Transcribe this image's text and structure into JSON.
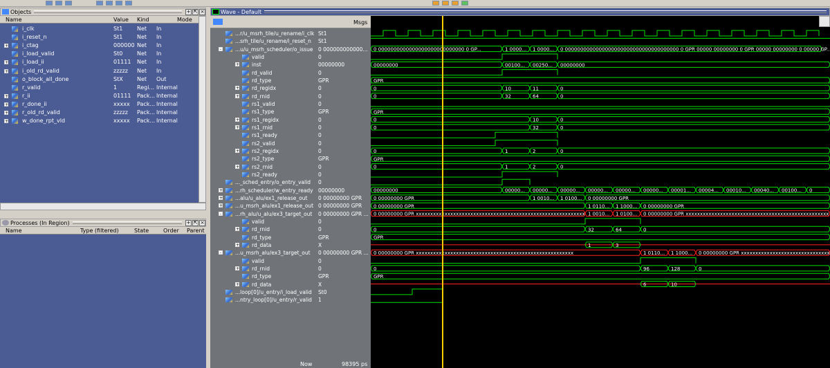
{
  "objects": {
    "title": "Objects",
    "columns": [
      "Name",
      "Value",
      "Kind",
      "Mode"
    ],
    "rows": [
      {
        "name": "i_clk",
        "value": "St1",
        "kind": "Net",
        "mode": "In",
        "expand": false
      },
      {
        "name": "i_reset_n",
        "value": "St1",
        "kind": "Net",
        "mode": "In",
        "expand": false
      },
      {
        "name": "i_ctag",
        "value": "000000",
        "kind": "Net",
        "mode": "In",
        "expand": true
      },
      {
        "name": "i_load_valid",
        "value": "St0",
        "kind": "Net",
        "mode": "In",
        "expand": false
      },
      {
        "name": "i_load_ii",
        "value": "01111",
        "kind": "Net",
        "mode": "In",
        "expand": true
      },
      {
        "name": "i_old_rd_valid",
        "value": "zzzzz",
        "kind": "Net",
        "mode": "In",
        "expand": true
      },
      {
        "name": "o_block_all_done",
        "value": "StX",
        "kind": "Net",
        "mode": "Out",
        "expand": false
      },
      {
        "name": "r_valid",
        "value": "1",
        "kind": "Regi...",
        "mode": "Internal",
        "expand": false
      },
      {
        "name": "r_ii",
        "value": "01111",
        "kind": "Pack...",
        "mode": "Internal",
        "expand": true
      },
      {
        "name": "r_done_ii",
        "value": "xxxxx",
        "kind": "Pack...",
        "mode": "Internal",
        "expand": true
      },
      {
        "name": "r_old_rd_valid",
        "value": "zzzzz",
        "kind": "Pack...",
        "mode": "Internal",
        "expand": true
      },
      {
        "name": "w_done_rpt_vld",
        "value": "xxxxx",
        "kind": "Pack...",
        "mode": "Internal",
        "expand": true
      }
    ]
  },
  "processes": {
    "title": "Processes (In Region)",
    "columns": [
      "Name",
      "Type (filtered)",
      "State",
      "Order",
      "Parent"
    ]
  },
  "wave": {
    "title": "Wave - Default",
    "msgs_label": "Msgs",
    "now_label": "Now",
    "now_value": "98395 ps",
    "signals": [
      {
        "name": "...r/u_msrh_tile/u_rename/i_clk",
        "value": "St1",
        "level": 0,
        "expand": ""
      },
      {
        "name": "...srh_tile/u_rename/i_reset_n",
        "value": "St1",
        "level": 0,
        "expand": ""
      },
      {
        "name": "...u/u_msrh_scheduler/o_issue",
        "value": "0 000000000000...",
        "level": 0,
        "expand": "-"
      },
      {
        "name": "valid",
        "value": "0",
        "level": 1,
        "expand": ""
      },
      {
        "name": "inst",
        "value": "00000000",
        "level": 1,
        "expand": "+"
      },
      {
        "name": "rd_valid",
        "value": "0",
        "level": 1,
        "expand": ""
      },
      {
        "name": "rd_type",
        "value": "GPR",
        "level": 1,
        "expand": ""
      },
      {
        "name": "rd_regidx",
        "value": "0",
        "level": 1,
        "expand": "+"
      },
      {
        "name": "rd_rnid",
        "value": "0",
        "level": 1,
        "expand": "+"
      },
      {
        "name": "rs1_valid",
        "value": "0",
        "level": 1,
        "expand": ""
      },
      {
        "name": "rs1_type",
        "value": "GPR",
        "level": 1,
        "expand": ""
      },
      {
        "name": "rs1_regidx",
        "value": "0",
        "level": 1,
        "expand": "+"
      },
      {
        "name": "rs1_rnid",
        "value": "0",
        "level": 1,
        "expand": "+"
      },
      {
        "name": "rs1_ready",
        "value": "0",
        "level": 1,
        "expand": ""
      },
      {
        "name": "rs2_valid",
        "value": "0",
        "level": 1,
        "expand": ""
      },
      {
        "name": "rs2_regidx",
        "value": "0",
        "level": 1,
        "expand": "+"
      },
      {
        "name": "rs2_type",
        "value": "GPR",
        "level": 1,
        "expand": ""
      },
      {
        "name": "rs2_rnid",
        "value": "0",
        "level": 1,
        "expand": "+"
      },
      {
        "name": "rs2_ready",
        "value": "0",
        "level": 1,
        "expand": ""
      },
      {
        "name": "..._sched_entry/o_entry_valid",
        "value": "0",
        "level": 0,
        "expand": ""
      },
      {
        "name": "...rh_scheduler/w_entry_ready",
        "value": "00000000",
        "level": 0,
        "expand": "+"
      },
      {
        "name": "...alu/u_alu/ex1_release_out",
        "value": "0 00000000 GPR",
        "level": 0,
        "expand": "+"
      },
      {
        "name": "...u_msrh_alu/ex1_release_out",
        "value": "0 00000000 GPR",
        "level": 0,
        "expand": "+"
      },
      {
        "name": "...rh_alu/u_alu/ex3_target_out",
        "value": "0 00000000 GPR ...",
        "level": 0,
        "expand": "-"
      },
      {
        "name": "valid",
        "value": "0",
        "level": 1,
        "expand": ""
      },
      {
        "name": "rd_rnid",
        "value": "0",
        "level": 1,
        "expand": "+"
      },
      {
        "name": "rd_type",
        "value": "GPR",
        "level": 1,
        "expand": ""
      },
      {
        "name": "rd_data",
        "value": "X",
        "level": 1,
        "expand": "+"
      },
      {
        "name": "...u_msrh_alu/ex3_target_out",
        "value": "0 00000000 GPR ...",
        "level": 0,
        "expand": "-"
      },
      {
        "name": "valid",
        "value": "0",
        "level": 1,
        "expand": ""
      },
      {
        "name": "rd_rnid",
        "value": "0",
        "level": 1,
        "expand": "+"
      },
      {
        "name": "rd_type",
        "value": "GPR",
        "level": 1,
        "expand": ""
      },
      {
        "name": "rd_data",
        "value": "X",
        "level": 1,
        "expand": "+"
      },
      {
        "name": "...loop[0]/u_entry/i_load_valid",
        "value": "St0",
        "level": 0,
        "expand": ""
      },
      {
        "name": "...ntry_loop[0]/u_entry/r_valid",
        "value": "1",
        "level": 0,
        "expand": ""
      }
    ],
    "bus_labels": {
      "o_issue": [
        "0 0000000000000000000000000000 0 GP...",
        "1 0000...",
        "1 0000...",
        "0 0000000000000000000000000000000000000 0 GPR 00000 00000000 0 GPR 00000 00000000 0 00000 GP..."
      ],
      "inst": [
        "00000000",
        "00100...",
        "00250...",
        "00000000"
      ],
      "rd_type": "GPR",
      "rd_regidx": [
        "0",
        "10",
        "11",
        "0"
      ],
      "rd_rnid": [
        "0",
        "32",
        "64",
        "0"
      ],
      "rs1_type": "GPR",
      "rs1_regidx": [
        "0",
        "10",
        "0"
      ],
      "rs1_rnid": [
        "0",
        "32",
        "0"
      ],
      "rs2_regidx": [
        "0",
        "1",
        "2",
        "0"
      ],
      "rs2_type": "GPR",
      "rs2_rnid": [
        "0",
        "1",
        "2",
        "0"
      ],
      "w_entry_ready": [
        "00000000",
        "00000...",
        "00000...",
        "00000...",
        "00000...",
        "00000...",
        "00000...",
        "00001...",
        "00004...",
        "00010...",
        "00040...",
        "00100...",
        "0"
      ],
      "ex1a": [
        "0 00000000 GPR",
        "1 0010...",
        "1 0100...",
        "0 00000000 GPR"
      ],
      "ex1b": [
        "0 00000000 GPR",
        "1 0110...",
        "1 1000...",
        "0 00000000 GPR"
      ],
      "ex3a": [
        "0 00000000 GPR xxxxxxxxxxxxxxxxxxxxxxxxxxxxxxxxxxxxxxxxxxxxxxxxxxxxxxxxxxx",
        "1 0010...",
        "1 0100...",
        "0 00000000 GPR xxxxxxxxxxxxxxxxxxxxxxxxxxxxxxxxxxxxxxxxxxxxxxxxxx"
      ],
      "ex3a_rnid": [
        "0",
        "32",
        "64",
        "0"
      ],
      "ex3a_type": "GPR",
      "ex3a_data": [
        "1",
        "3"
      ],
      "ex3b": [
        "0 00000000 GPR xxxxxxxxxxxxxxxxxxxxxxxxxxxxxxxxxxxxxxxxxxxxxxxxxxxxxxx",
        "1 0110...",
        "1 1000...",
        "0 00000000 GPR xxxxxxxxxxxxxxxxxxxxxxxxxxxxxxxx"
      ],
      "ex3b_rnid": [
        "0",
        "96",
        "128",
        "0"
      ],
      "ex3b_type": "GPR",
      "ex3b_data": [
        "6",
        "10"
      ]
    }
  },
  "colors": {
    "panel": "#4b5b93",
    "wave_bg": "#000000",
    "signal": "#00e000",
    "cursor": "#ffcc00",
    "xvalue": "#ff2020",
    "signal_list": "#707478"
  }
}
